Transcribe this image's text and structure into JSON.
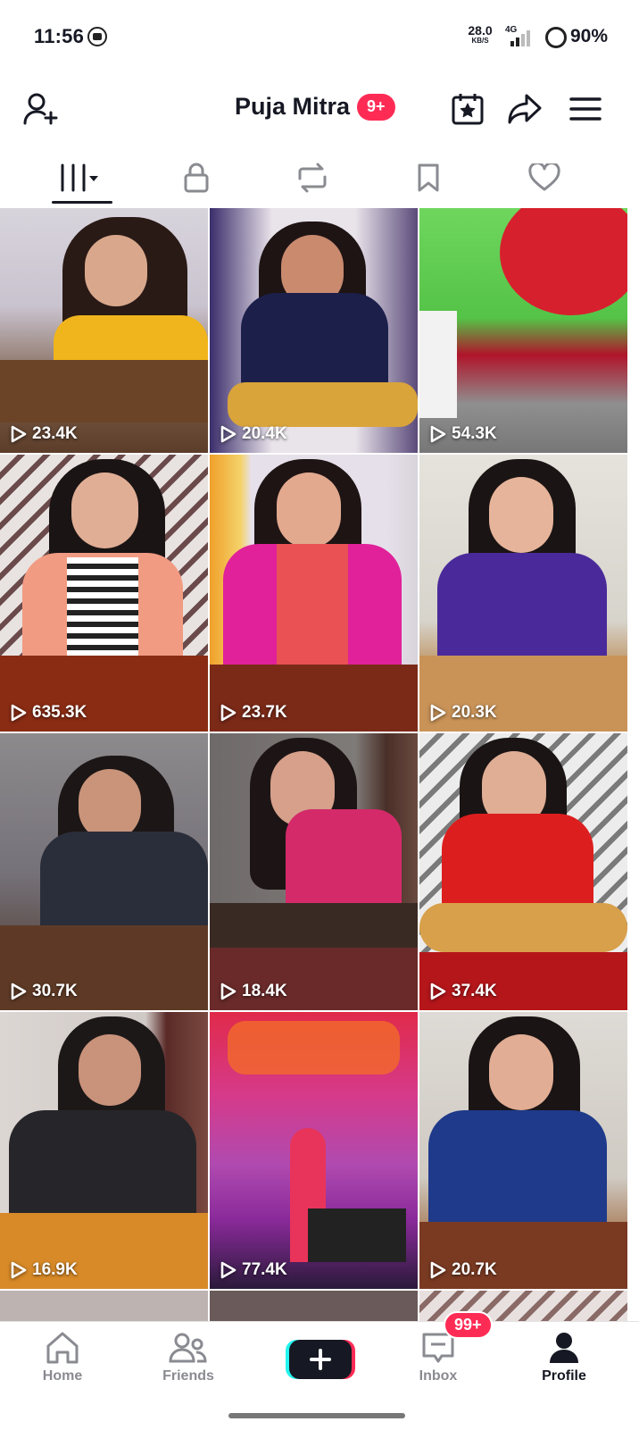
{
  "status_bar": {
    "time": "11:56",
    "speed_value": "28.0",
    "speed_unit": "KB/S",
    "network": "4G",
    "battery": "90%"
  },
  "header": {
    "title": "Puja Mitra",
    "notification_badge": "9+",
    "icons": [
      "add-friend-icon",
      "calendar-star-icon",
      "share-icon",
      "menu-icon"
    ]
  },
  "tabs": [
    {
      "name": "videos",
      "icon": "grid-icon",
      "active": true
    },
    {
      "name": "private",
      "icon": "lock-icon",
      "active": false
    },
    {
      "name": "reposts",
      "icon": "repost-icon",
      "active": false
    },
    {
      "name": "favorites",
      "icon": "bookmark-icon",
      "active": false
    },
    {
      "name": "liked",
      "icon": "heart-icon",
      "active": false
    }
  ],
  "videos": [
    {
      "views": "23.4K"
    },
    {
      "views": "20.4K"
    },
    {
      "views": "54.3K"
    },
    {
      "views": "635.3K"
    },
    {
      "views": "23.7K"
    },
    {
      "views": "20.3K"
    },
    {
      "views": "30.7K"
    },
    {
      "views": "18.4K"
    },
    {
      "views": "37.4K"
    },
    {
      "views": "16.9K"
    },
    {
      "views": "77.4K"
    },
    {
      "views": "20.7K"
    }
  ],
  "bottom_nav": {
    "home": "Home",
    "friends": "Friends",
    "inbox": "Inbox",
    "inbox_badge": "99+",
    "profile": "Profile"
  }
}
